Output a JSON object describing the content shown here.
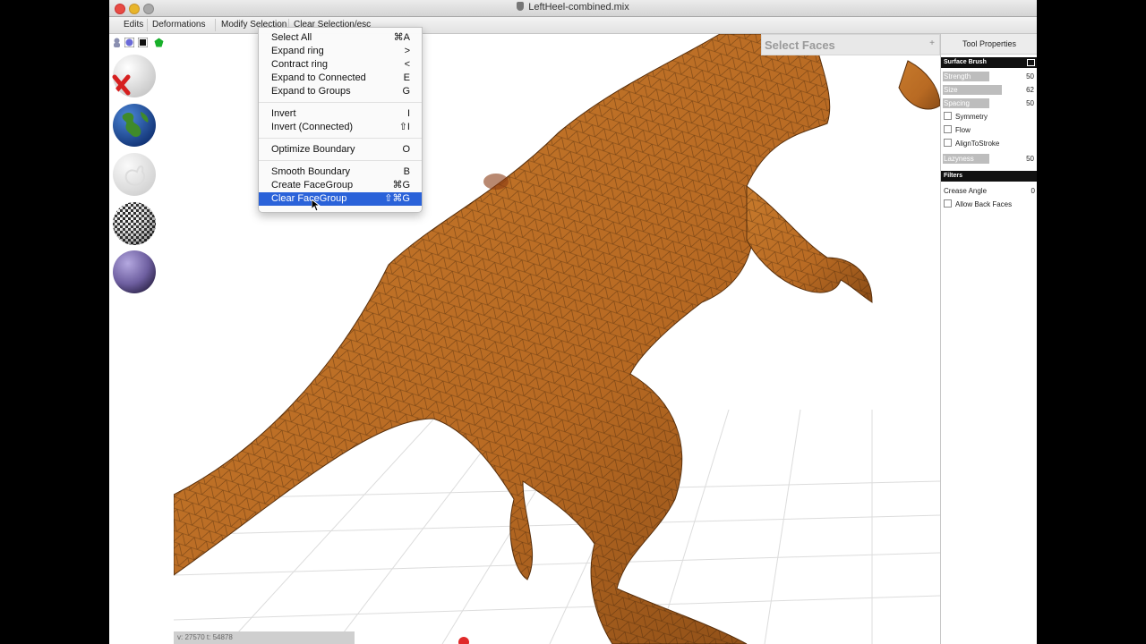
{
  "window": {
    "title": "LeftHeel-combined.mix"
  },
  "menubar": {
    "items": [
      "Edits",
      "Deformations",
      "Modify Selection",
      "Clear Selection/esc"
    ]
  },
  "dropdown": {
    "items": [
      {
        "label": "Select All",
        "shortcut": "⌘A"
      },
      {
        "label": "Expand ring",
        "shortcut": ">"
      },
      {
        "label": "Contract ring",
        "shortcut": "<"
      },
      {
        "label": "Expand to Connected",
        "shortcut": "E"
      },
      {
        "label": "Expand to Groups",
        "shortcut": "G"
      },
      {
        "label": "Invert",
        "shortcut": "I"
      },
      {
        "label": "Invert (Connected)",
        "shortcut": "⇧I"
      },
      {
        "label": "Optimize Boundary",
        "shortcut": "O"
      },
      {
        "label": "Smooth Boundary",
        "shortcut": "B"
      },
      {
        "label": "Create FaceGroup",
        "shortcut": "⌘G"
      },
      {
        "label": "Clear FaceGroup",
        "shortcut": "⇧⌘G"
      }
    ],
    "highlighted_index": 10
  },
  "viewport": {
    "tool_header": "Select Faces",
    "tool_header_plus": "+",
    "status": "v: 27570  t: 54878"
  },
  "properties": {
    "title": "Tool Properties",
    "surface_brush": {
      "heading": "Surface Brush",
      "strength": {
        "label": "Strength",
        "value": "50",
        "fraction": 0.5
      },
      "size": {
        "label": "Size",
        "value": "62",
        "fraction": 0.62
      },
      "spacing": {
        "label": "Spacing",
        "value": "50",
        "fraction": 0.5
      },
      "symmetry": "Symmetry",
      "flow": "Flow",
      "align_to_stroke": "AlignToStroke",
      "lazyness": {
        "label": "Lazyness",
        "value": "50",
        "fraction": 0.5
      }
    },
    "filters": {
      "heading": "Filters",
      "crease_angle": {
        "label": "Crease Angle",
        "value": "0"
      },
      "allow_back_faces": "Allow Back Faces"
    }
  },
  "colors": {
    "model": "#b86a23",
    "menu_highlight": "#2a62d9",
    "sphere_purple": "#6e5fa0",
    "sphere_earth_blue": "#1e4fa6"
  }
}
